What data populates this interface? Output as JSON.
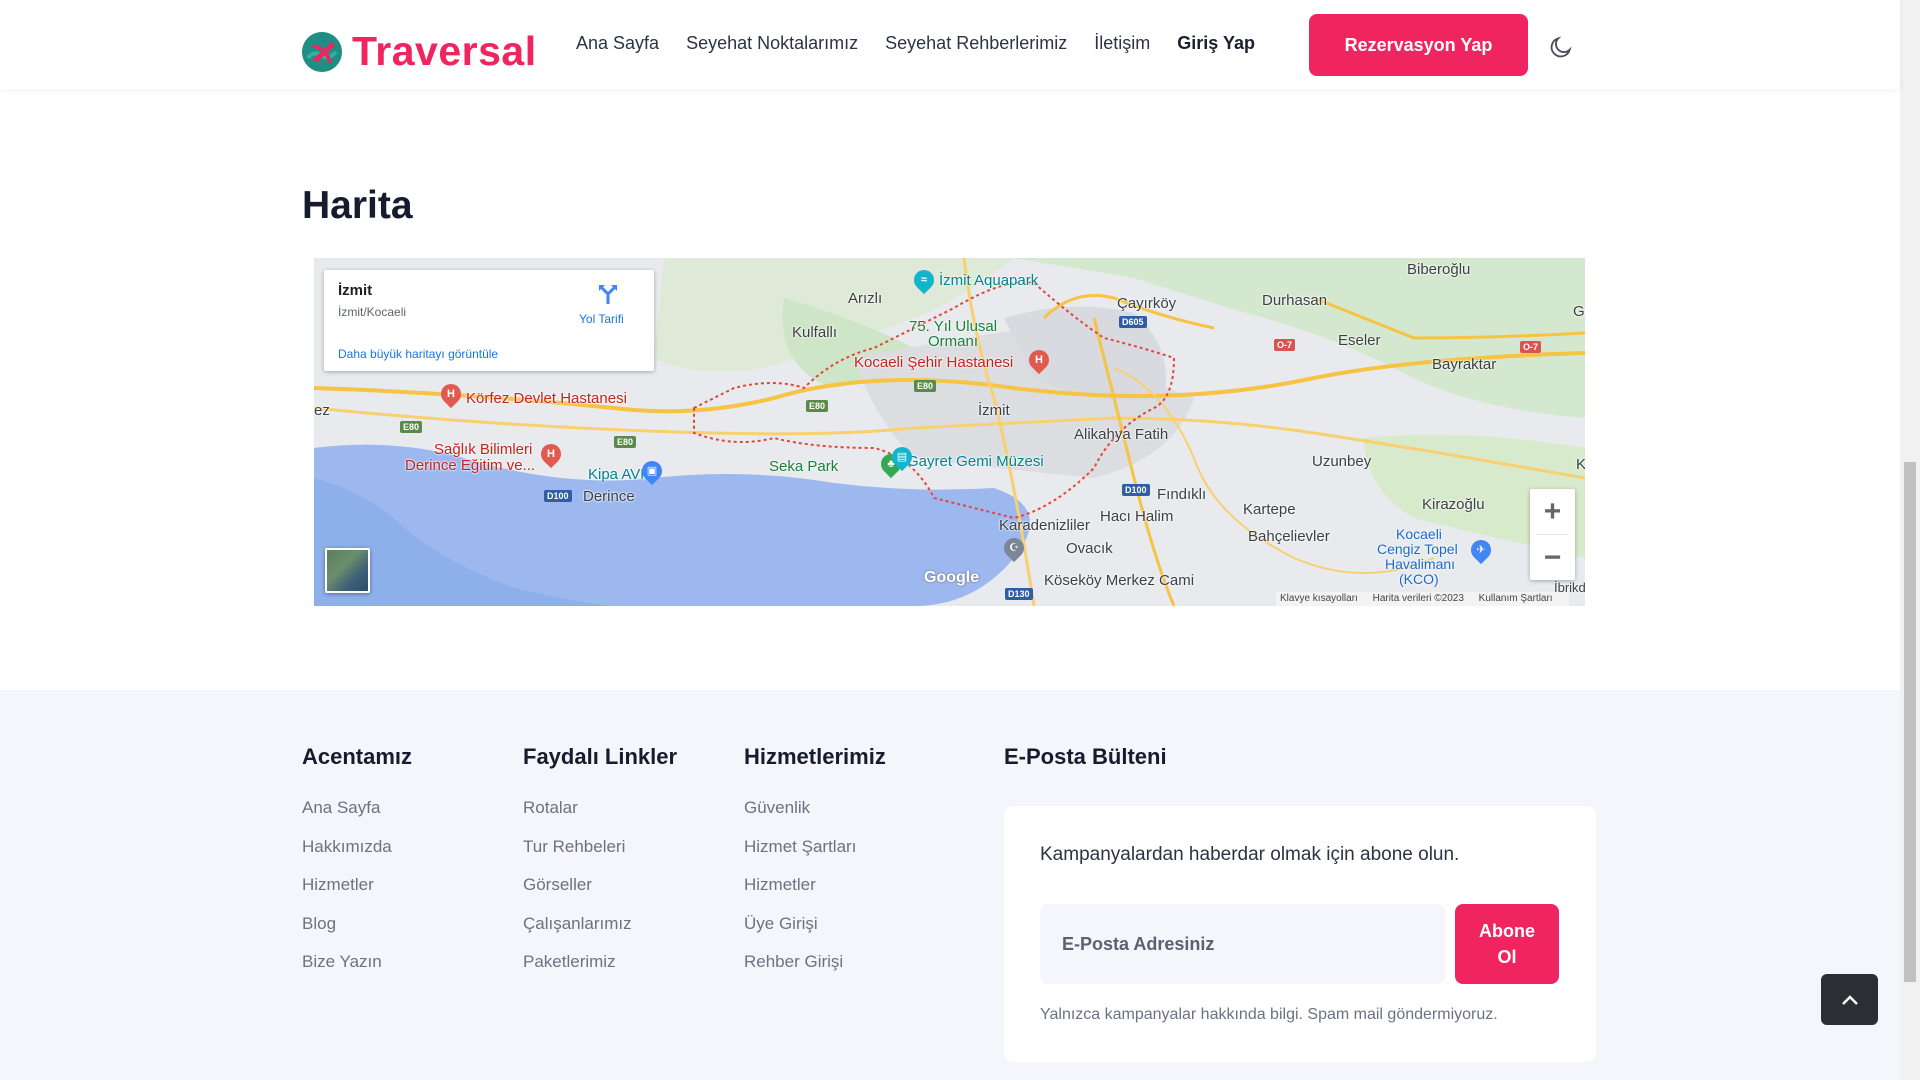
{
  "header": {
    "logo_text": "Traversal",
    "nav": [
      "Ana Sayfa",
      "Seyehat Noktalarımız",
      "Seyehat Rehberlerimiz",
      "İletişim",
      "Giriş Yap"
    ],
    "book_button": "Rezervasyon Yap",
    "theme_icon": "moon-icon"
  },
  "map_section": {
    "title": "Harita",
    "info_card": {
      "title": "İzmit",
      "subtitle": "İzmit/Kocaeli",
      "directions_label": "Yol Tarifi",
      "larger_map_link": "Daha büyük haritayı görüntüle"
    },
    "labels": {
      "biberoglu": "Biberoğlu",
      "izmit_aquapark": "İzmit Aquapark",
      "arizli": "Arızlı",
      "cayirkoy": "Çayırköy",
      "durhasan": "Durhasan",
      "gedikli": "Gedikli",
      "kulfalli": "Kulfallı",
      "yil_ulusal_1": "75. Yıl Ulusal",
      "yil_ulusal_2": "Ormanı",
      "eseler": "Eseler",
      "bayraktar": "Bayraktar",
      "kocaeli_hastane": "Kocaeli Şehir Hastanesi",
      "korfez_hastane": "Körfez Devlet Hastanesi",
      "izmit": "İzmit",
      "alikahya": "Alikahya Fatih",
      "saglik_1": "Sağlık Bilimleri",
      "saglik_2": "Derince Eğitim ve...",
      "uzunbey": "Uzunbey",
      "seka_park": "Seka Park",
      "gayret": "Gayret Gemi Müzesi",
      "kipa": "Kipa AVM",
      "derince": "Derince",
      "findikli": "Fındıklı",
      "kirazoglu": "Kirazoğlu",
      "kartepe": "Kartepe",
      "haci_halim": "Hacı Halim",
      "karadenizliler": "Karadenizliler",
      "bahcelievler": "Bahçelievler",
      "ovacik": "Ovacık",
      "kocaeli_airport_1": "Kocaeli",
      "kocaeli_airport_2": "Cengiz Topel",
      "kocaeli_airport_3": "Havalimanı",
      "kocaeli_airport_4": "(KCO)",
      "ibrikdere": "İbrikdere",
      "koseköy": "Köseköy Merkez Cami",
      "ez": "ez",
      "k": "K"
    },
    "roads": [
      "D605",
      "E80",
      "E80",
      "E80",
      "E80",
      "D100",
      "D100",
      "D130",
      "O-7",
      "O-7"
    ],
    "zoom_in": "+",
    "zoom_out": "−",
    "google": "Google",
    "attribution": [
      "Klavye kısayolları",
      "Harita verileri ©2023",
      "Kullanım Şartları"
    ]
  },
  "footer": {
    "col1": {
      "title": "Acentamız",
      "links": [
        "Ana Sayfa",
        "Hakkımızda",
        "Hizmetler",
        "Blog",
        "Bize Yazın"
      ]
    },
    "col2": {
      "title": "Faydalı Linkler",
      "links": [
        "Rotalar",
        "Tur Rehbeleri",
        "Görseller",
        "Çalışanlarımız",
        "Paketlerimiz"
      ]
    },
    "col3": {
      "title": "Hizmetlerimiz",
      "links": [
        "Güvenlik",
        "Hizmet Şartları",
        "Hizmetler",
        "Üye Girişi",
        "Rehber Girişi"
      ]
    },
    "newsletter": {
      "title": "E-Posta Bülteni",
      "text": "Kampanyalardan haberdar olmak için abone olun.",
      "placeholder": "E-Posta Adresiniz",
      "button_line1": "Abone",
      "button_line2": "Ol",
      "note": "Yalnızca kampanyalar hakkında bilgi. Spam mail göndermiyoruz."
    }
  },
  "colors": {
    "accent": "#f0245e",
    "dark": "#161c2d",
    "muted": "#6c7281",
    "footer_bg": "#f5f6fb"
  }
}
